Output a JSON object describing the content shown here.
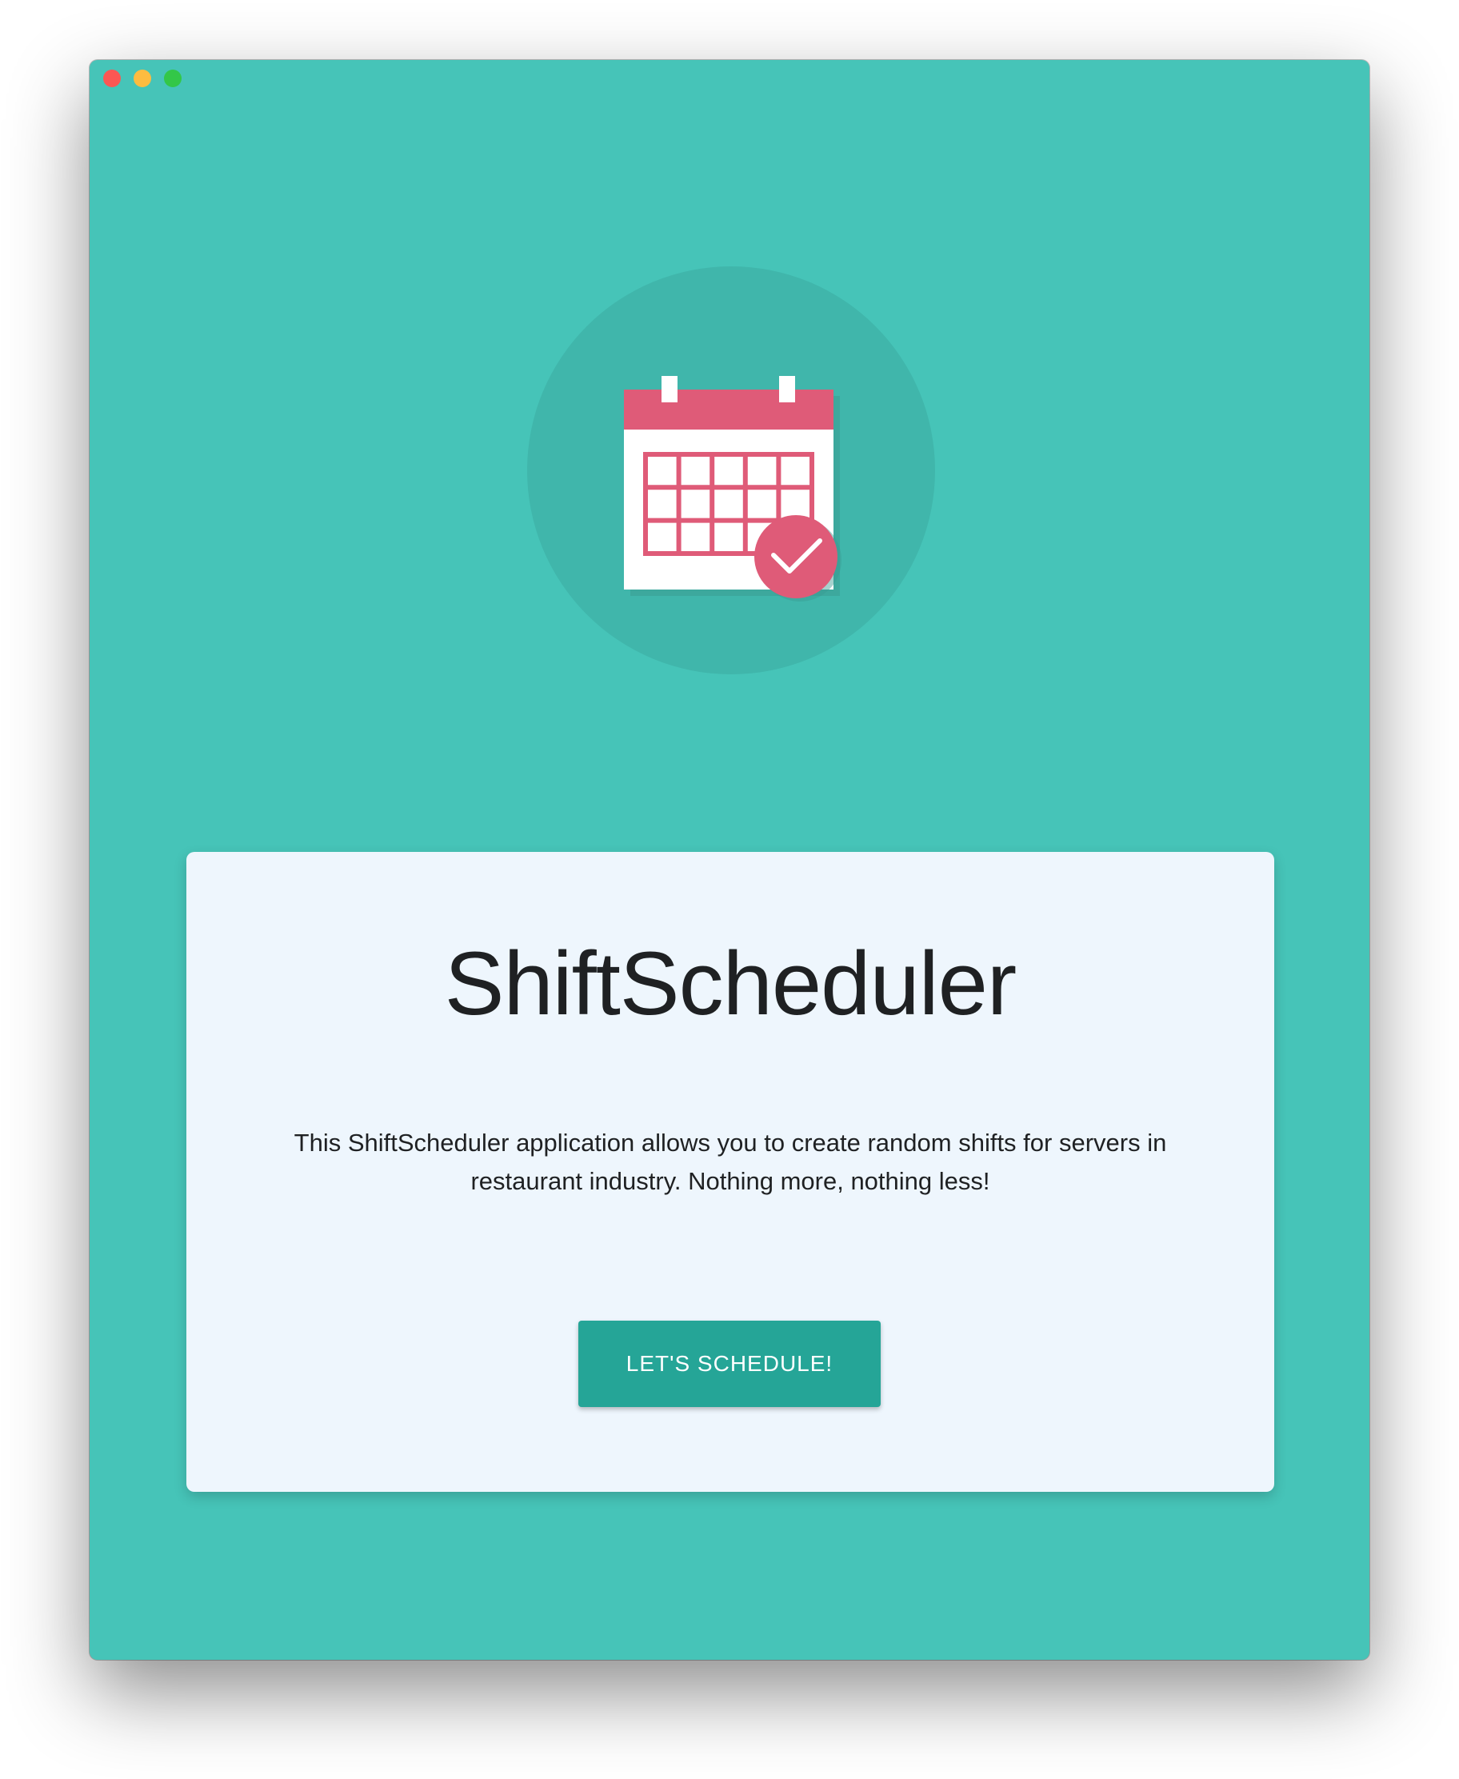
{
  "window": {
    "background_color": "#46c4b8",
    "traffic_lights": [
      "close",
      "minimize",
      "zoom"
    ]
  },
  "hero": {
    "icon": "calendar-check-icon",
    "circle_color": "#40b6ab",
    "accent_color": "#df5b78"
  },
  "card": {
    "title": "ShiftScheduler",
    "description": "This ShiftScheduler application allows you to create random shifts for servers in restaurant industry. Nothing more, nothing less!",
    "button_label": "LET'S SCHEDULE!",
    "button_color": "#25a597"
  }
}
